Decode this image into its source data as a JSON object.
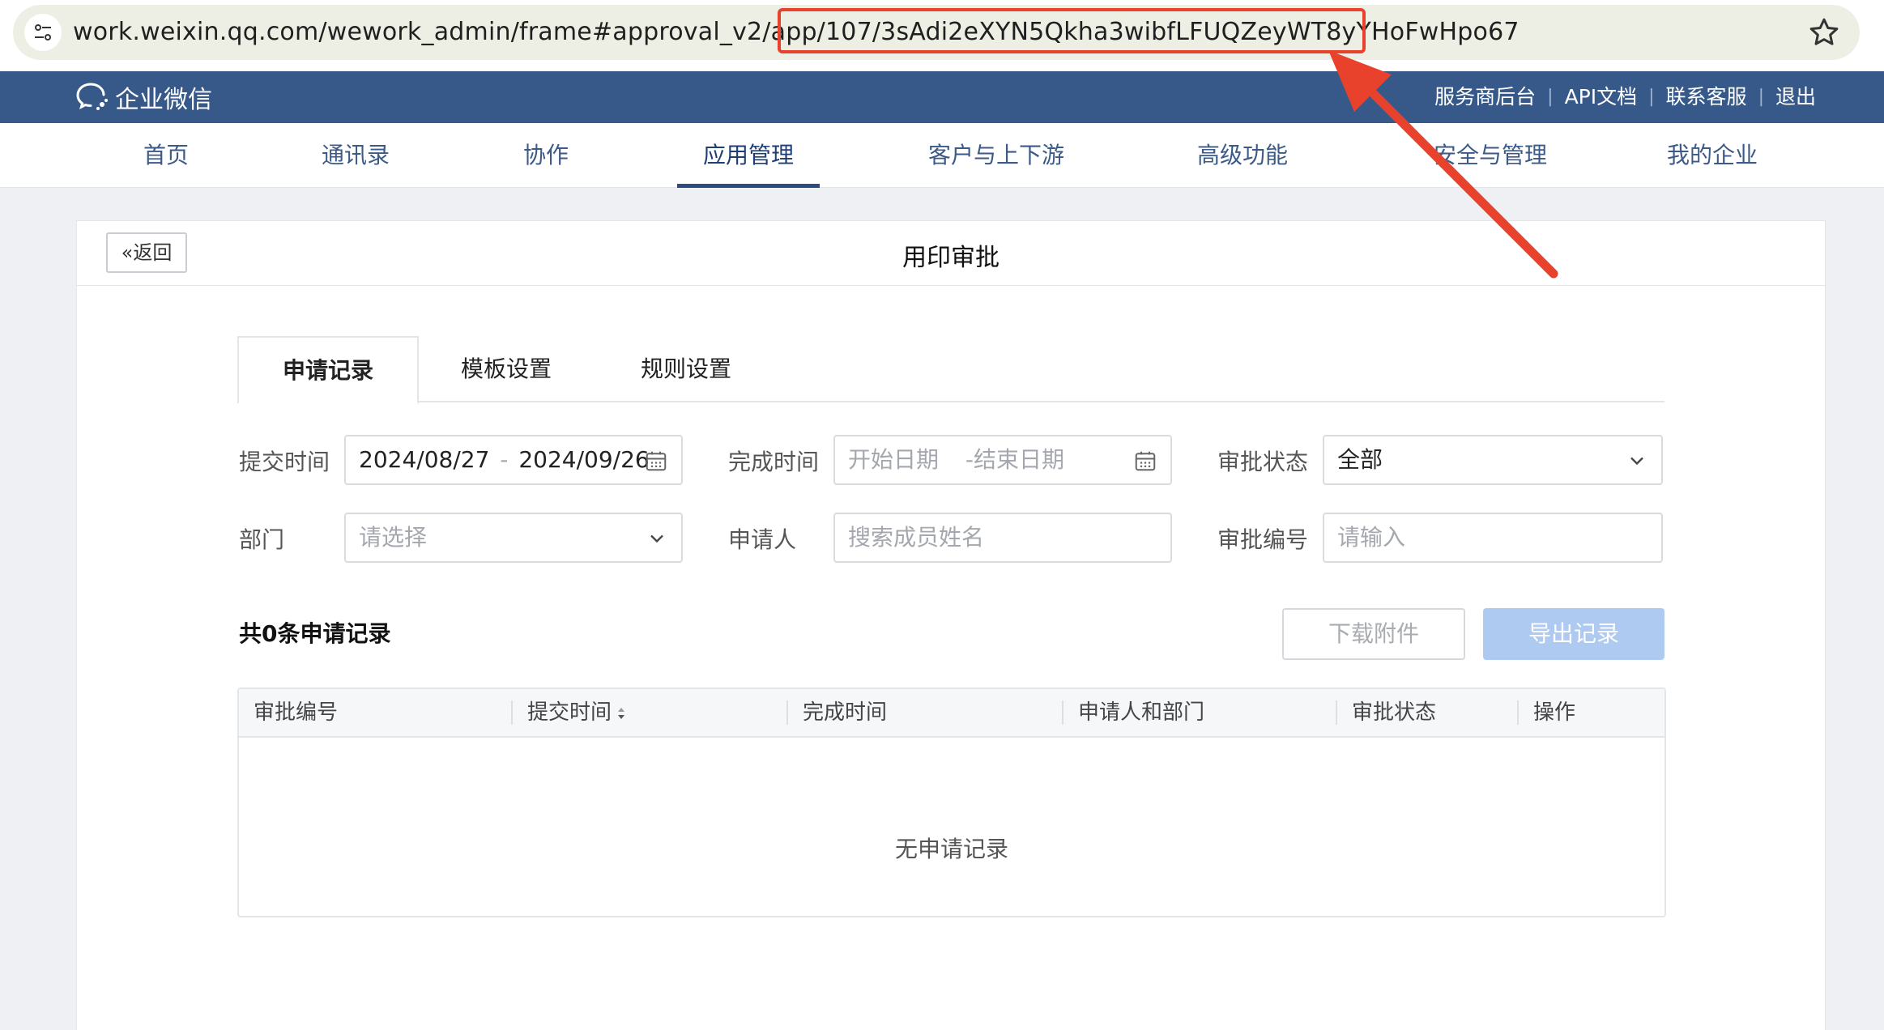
{
  "browser": {
    "url_prefix": "work.weixin.qq.com/wework_admin/frame#approval_v2/app/107/",
    "url_highlight": "3sAdi2eXYN5Qkha3wibfLFUQZeyWT8yYHoFwHpo67"
  },
  "header": {
    "logo_text": "企业微信",
    "links": [
      "服务商后台",
      "API文档",
      "联系客服",
      "退出"
    ]
  },
  "nav": {
    "items": [
      "首页",
      "通讯录",
      "协作",
      "应用管理",
      "客户与上下游",
      "高级功能",
      "安全与管理",
      "我的企业"
    ],
    "active": "应用管理"
  },
  "page": {
    "back_label": "返回",
    "title": "用印审批"
  },
  "tabs": [
    "申请记录",
    "模板设置",
    "规则设置"
  ],
  "filters": {
    "submit_time_label": "提交时间",
    "submit_start": "2024/08/27",
    "submit_end": "2024/09/26",
    "finish_time_label": "完成时间",
    "finish_start_placeholder": "开始日期",
    "finish_end_placeholder": "结束日期",
    "status_label": "审批状态",
    "status_value": "全部",
    "dept_label": "部门",
    "dept_placeholder": "请选择",
    "applicant_label": "申请人",
    "applicant_placeholder": "搜索成员姓名",
    "number_label": "审批编号",
    "number_placeholder": "请输入"
  },
  "list": {
    "count_text": "共0条申请记录",
    "download_label": "下载附件",
    "export_label": "导出记录",
    "columns": [
      "审批编号",
      "提交时间",
      "完成时间",
      "申请人和部门",
      "审批状态",
      "操作"
    ],
    "empty_text": "无申请记录"
  },
  "colors": {
    "header_bg": "#36598a",
    "nav_active": "#2c4d80",
    "export_disabled": "#aecaf1",
    "annotation": "#e8412c"
  }
}
